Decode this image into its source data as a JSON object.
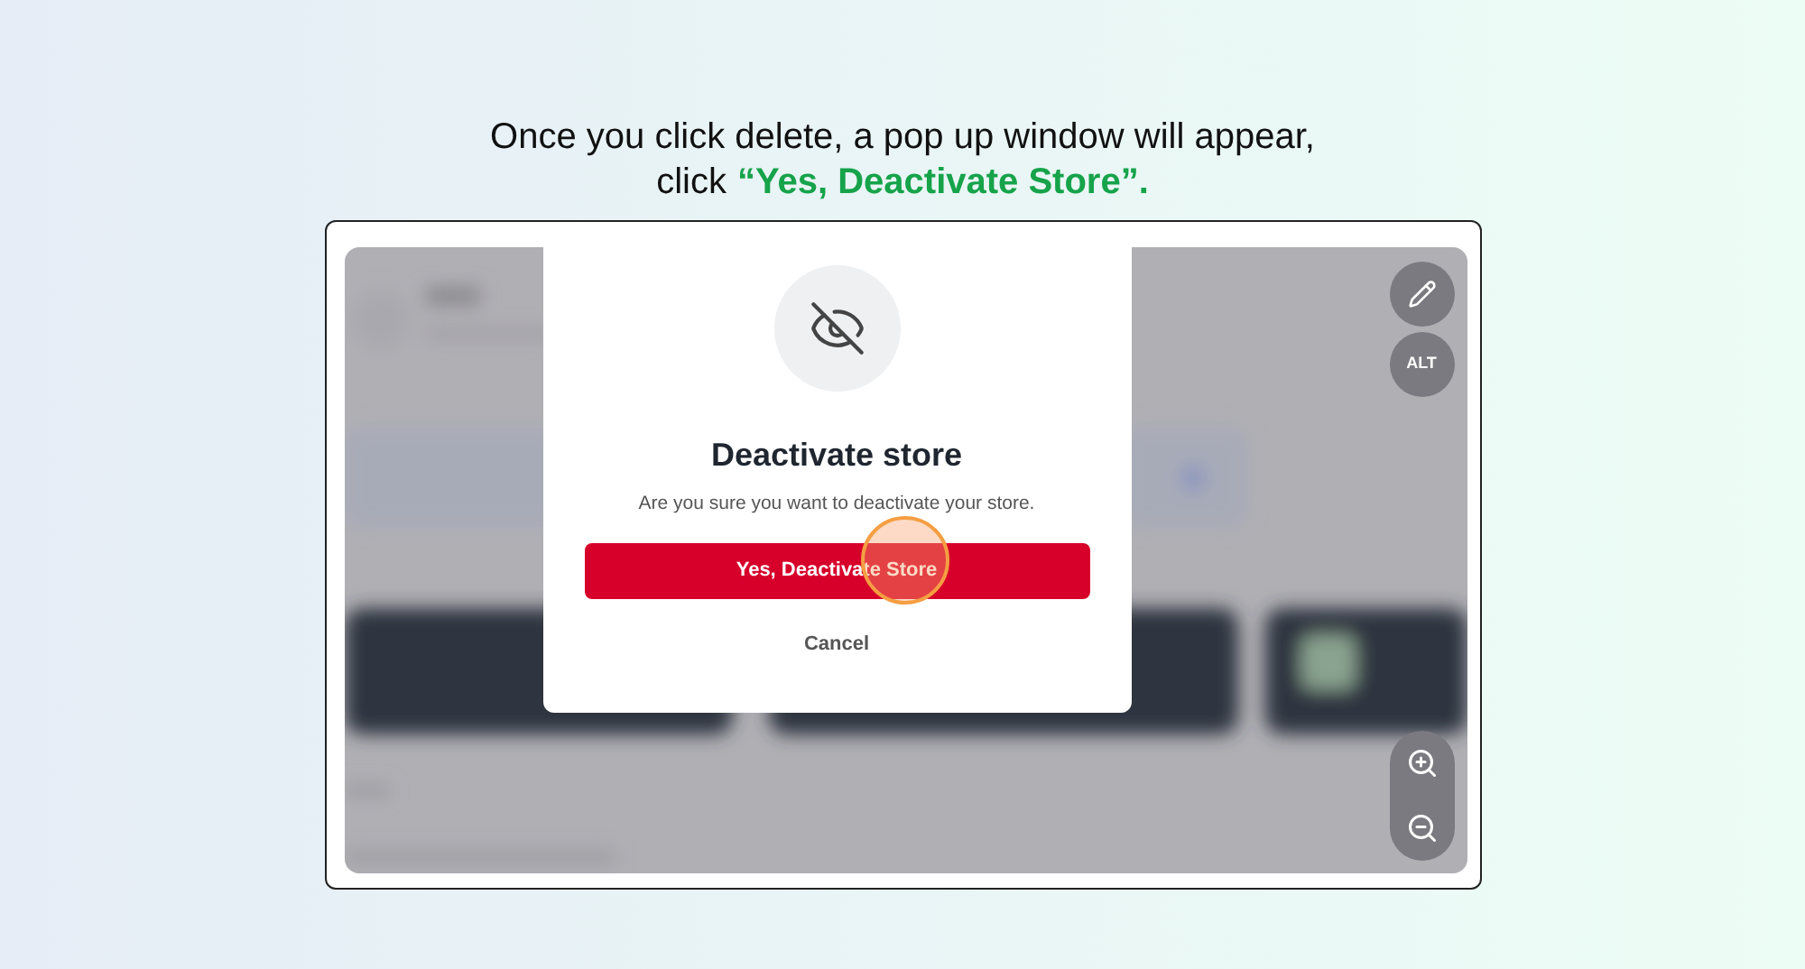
{
  "instruction": {
    "line_1": "Once you click delete, a pop up window will appear,",
    "line_2": {
      "lead": "click",
      "highlight": "“Yes, Deactivate Store”."
    }
  },
  "dialog": {
    "title": "Deactivate store",
    "message": "Are you sure you want to deactivate your store.",
    "confirm_button": "Yes, Deactivate Store",
    "cancel_button": "Cancel"
  },
  "side_controls": {
    "alt_button": "ALT"
  }
}
